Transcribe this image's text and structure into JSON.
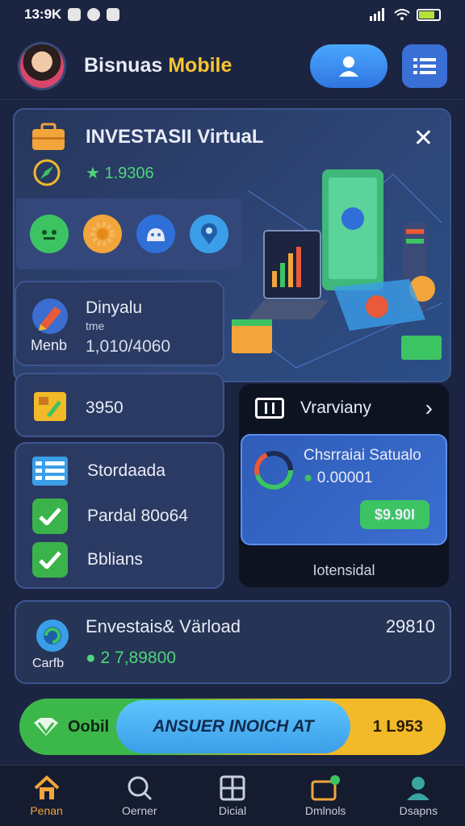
{
  "status": {
    "time": "13:9K",
    "battery_level": 0.8
  },
  "header": {
    "brand_main": "Bisnuas",
    "brand_accent": "Mobile"
  },
  "hero": {
    "title": "INVESTASII VirtuaL",
    "value": "1.9306",
    "close": "✕"
  },
  "cards": {
    "dinyalu": {
      "title": "Dinyalu",
      "sub": "tme",
      "side": "Menb",
      "value": "1,010/4060"
    },
    "row2": {
      "value": "3950"
    },
    "checklist": [
      {
        "label": "Stordaada"
      },
      {
        "label": "Pardal  80o64"
      },
      {
        "label": "Bblians"
      }
    ]
  },
  "right_panel": {
    "head": "Vrarviany",
    "card_title": "Chsrraiai Satualo",
    "card_amount": "0.00001",
    "pill": "$9.90I",
    "footer": "Iotensidal"
  },
  "investasi": {
    "title": "Envestais& Värload",
    "side": "Carfb",
    "amount": "2 7,89800",
    "right": "29810"
  },
  "action_bar": {
    "left": "Oobil",
    "center": "ANSUER INOICH  AT",
    "right": "1 L953"
  },
  "nav": [
    {
      "label": "Penan",
      "icon": "home-icon"
    },
    {
      "label": "Oerner",
      "icon": "search-icon"
    },
    {
      "label": "Dicial",
      "icon": "grid-icon"
    },
    {
      "label": "Dmlnols",
      "icon": "wallet-icon"
    },
    {
      "label": "Dsapns",
      "icon": "user-icon"
    }
  ],
  "colors": {
    "accent": "#f7c531",
    "green": "#3cc463",
    "blue": "#3b9ee8",
    "bg": "#1b2440"
  }
}
